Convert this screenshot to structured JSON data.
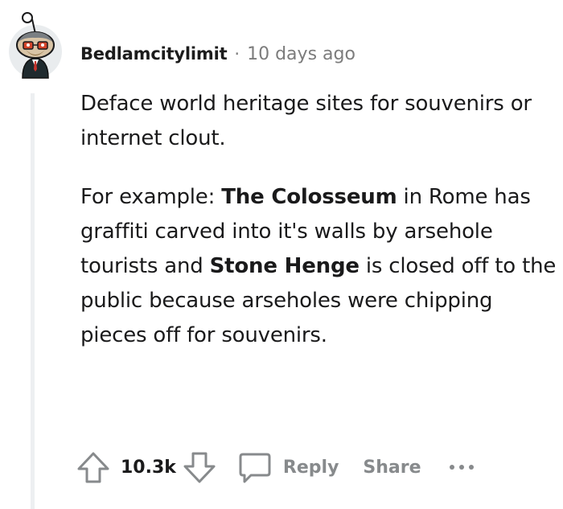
{
  "comment": {
    "author": "Bedlamcitylimit",
    "separator": "·",
    "timestamp": "10 days ago",
    "paragraph1": "Deface world heritage sites for souvenirs or internet clout.",
    "paragraph2": {
      "part1": "For example: ",
      "bold1": "The Colosseum",
      "part2": " in Rome has graffiti carved into it's walls by arsehole tourists and ",
      "bold2": "Stone Henge",
      "part3": " is closed off to the public because arseholes were chipping pieces off for souvenirs."
    }
  },
  "actions": {
    "upvote_icon": "arrow-up-icon",
    "vote_count": "10.3k",
    "downvote_icon": "arrow-down-icon",
    "reply_icon": "speech-bubble-icon",
    "reply_label": "Reply",
    "share_label": "Share",
    "more_icon": "ellipsis-icon"
  },
  "colors": {
    "text": "#1a1a1b",
    "muted": "#878a8c",
    "thread_line": "#edeff1"
  }
}
